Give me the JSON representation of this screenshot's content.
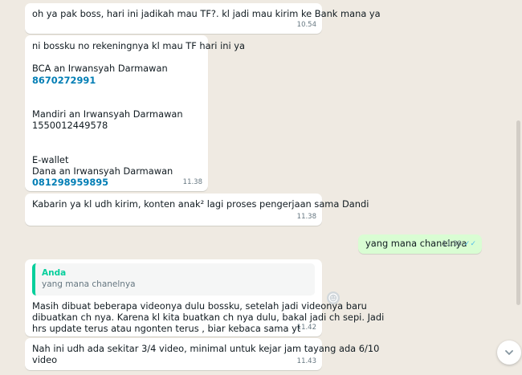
{
  "messages": [
    {
      "lines": [
        "oh ya pak boss, hari ini jadikah mau TF?. kl jadi mau kirim ke Bank mana ya"
      ],
      "time": "10.54"
    },
    {
      "lines": [
        "ni bossku no rekeningnya kl mau TF hari ini ya",
        "",
        "BCA an Irwansyah Darmawan",
        "8670272991",
        "",
        "",
        "Mandiri an Irwansyah Darmawan",
        "1550012449578",
        "",
        "",
        "E-wallet",
        "Dana an Irwansyah Darmawan",
        "081298959895"
      ],
      "time": "11.38"
    },
    {
      "lines": [
        "Kabarin ya kl udh kirim, konten anak² lagi proses pengerjaan sama Dandi"
      ],
      "time": "11.38"
    },
    {
      "lines": [
        "yang mana chanelnya"
      ],
      "time": "11.39"
    },
    {
      "quote_author": "Anda",
      "quote_text": "yang mana chanelnya",
      "lines": [
        "Masih dibuat beberapa videonya dulu bossku, setelah jadi videonya baru",
        "dibuatkan ch nya. Karena kl kita buatkan ch nya dulu, bakal jadi ch sepi. Jadi",
        "hrs update terus atau ngonten terus , biar kebaca sama yt"
      ],
      "time": "11.42"
    },
    {
      "lines": [
        "Nah ini udh ada sekitar 3/4 video, minimal untuk kejar jam tayang ada 6/10",
        "video"
      ],
      "time": "11.43"
    }
  ]
}
